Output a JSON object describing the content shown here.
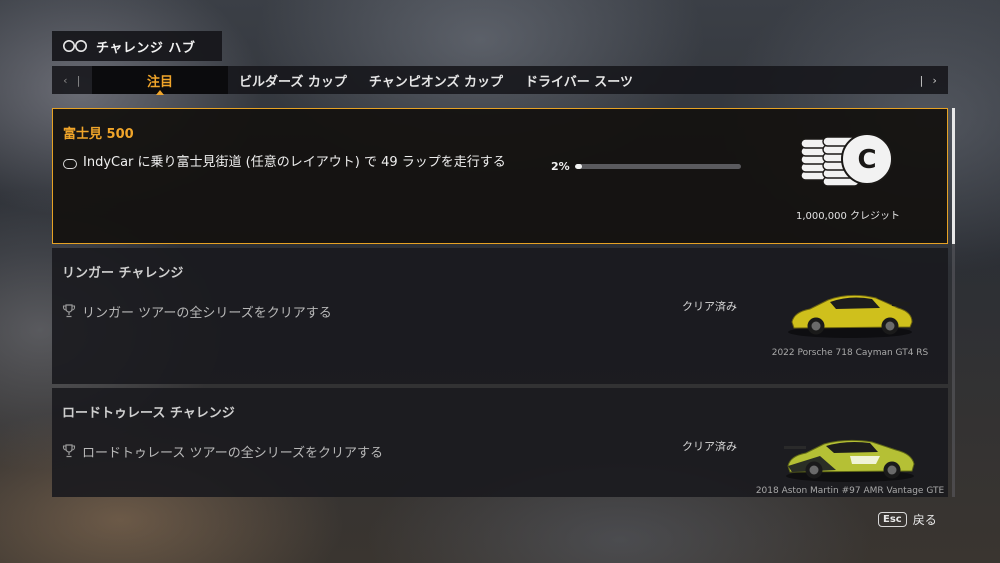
{
  "header": {
    "title": "チャレンジ ハブ",
    "icon": "infinity-loop-icon"
  },
  "tabs": {
    "prev_label": "‹ |",
    "next_label": "| ›",
    "items": [
      {
        "label": "注目",
        "active": true
      },
      {
        "label": "ビルダーズ カップ",
        "active": false
      },
      {
        "label": "チャンピオンズ カップ",
        "active": false
      },
      {
        "label": "ドライバー スーツ",
        "active": false
      }
    ]
  },
  "challenges": [
    {
      "title": "富士見 500",
      "goal": "IndyCar に乗り富士見街道 (任意のレイアウト) で 49 ラップを走行する",
      "goal_icon": "ring-icon",
      "progress_text": "2%",
      "progress": 0.02,
      "reward": "1,000,000 クレジット",
      "reward_icon": "credits-coins-icon",
      "accent": "#f0a52a"
    },
    {
      "title": "リンガー チャレンジ",
      "goal": "リンガー ツアーの全シリーズをクリアする",
      "goal_icon": "trophy-icon",
      "status": "クリア済み",
      "reward": "2022 Porsche 718 Cayman GT4 RS",
      "car_color": "#d4c21a"
    },
    {
      "title": "ロードトゥレース チャレンジ",
      "goal": "ロードトゥレース ツアーの全シリーズをクリアする",
      "goal_icon": "trophy-icon",
      "status": "クリア済み",
      "reward": "2018 Aston Martin #97 AMR Vantage GTE",
      "car_color": "#b9c43a"
    }
  ],
  "footer": {
    "key": "Esc",
    "label": "戻る"
  }
}
